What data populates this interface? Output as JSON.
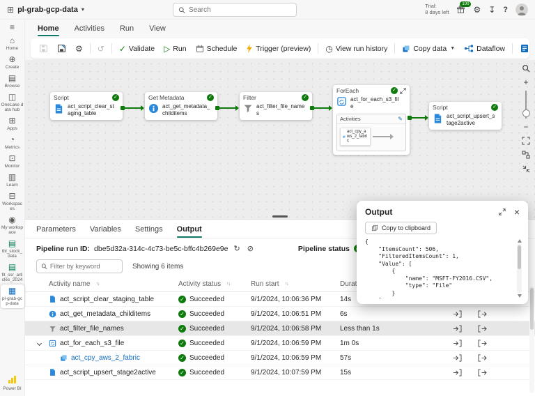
{
  "topbar": {
    "workspace": "pl-grab-gcp-data",
    "search_placeholder": "Search",
    "trial_line1": "Trial:",
    "trial_line2": "8 days left",
    "badge": "100"
  },
  "sidebar": {
    "items": [
      {
        "label": "Home"
      },
      {
        "label": "Create"
      },
      {
        "label": "Browse"
      },
      {
        "label": "OneLake data hub"
      },
      {
        "label": "Apps"
      },
      {
        "label": "Metrics"
      },
      {
        "label": "Monitor"
      },
      {
        "label": "Learn"
      },
      {
        "label": "Workspaces"
      },
      {
        "label": "My workspace"
      },
      {
        "label": "tbl_stock_data"
      },
      {
        "label": "fit_ssr_articles_2024"
      },
      {
        "label": "pl-grab-gcp-data"
      },
      {
        "label": "Power BI"
      }
    ]
  },
  "menu": {
    "tabs": [
      {
        "label": "Home"
      },
      {
        "label": "Activities"
      },
      {
        "label": "Run"
      },
      {
        "label": "View"
      }
    ]
  },
  "toolbar": {
    "validate": "Validate",
    "run": "Run",
    "schedule": "Schedule",
    "trigger": "Trigger (preview)",
    "history": "View run history",
    "copy_data": "Copy data",
    "dataflow": "Dataflow"
  },
  "canvas": {
    "nodes": [
      {
        "type": "Script",
        "name": "act_script_clear_staging_table"
      },
      {
        "type": "Get Metadata",
        "name": "act_get_metadata_childitems"
      },
      {
        "type": "Filter",
        "name": "act_filter_file_names"
      },
      {
        "type": "ForEach",
        "name": "act_for_each_s3_file",
        "activities_label": "Activities",
        "inner_name": "act_cpy_aws_2_fabric"
      },
      {
        "type": "Script",
        "name": "act_script_upsert_stage2active"
      }
    ]
  },
  "panel": {
    "tabs": [
      {
        "label": "Parameters"
      },
      {
        "label": "Variables"
      },
      {
        "label": "Settings"
      },
      {
        "label": "Output"
      }
    ],
    "run_id_label": "Pipeline run ID:",
    "run_id": "dbe5d32a-314c-4c73-be5c-bffc4b269e9e",
    "status_label": "Pipeline status",
    "status_value": "Succeeded",
    "filter_placeholder": "Filter by keyword",
    "showing": "Showing 6 items",
    "columns": [
      {
        "label": "Activity name"
      },
      {
        "label": "Activity status"
      },
      {
        "label": "Run start"
      },
      {
        "label": "Duration"
      }
    ],
    "rows": [
      {
        "name": "act_script_clear_staging_table",
        "status": "Succeeded",
        "start": "9/1/2024, 10:06:36 PM",
        "duration": "14s"
      },
      {
        "name": "act_get_metadata_childitems",
        "status": "Succeeded",
        "start": "9/1/2024, 10:06:51 PM",
        "duration": "6s"
      },
      {
        "name": "act_filter_file_names",
        "status": "Succeeded",
        "start": "9/1/2024, 10:06:58 PM",
        "duration": "Less than 1s"
      },
      {
        "name": "act_for_each_s3_file",
        "status": "Succeeded",
        "start": "9/1/2024, 10:06:59 PM",
        "duration": "1m 0s"
      },
      {
        "name": "act_cpy_aws_2_fabric",
        "status": "Succeeded",
        "start": "9/1/2024, 10:06:59 PM",
        "duration": "57s"
      },
      {
        "name": "act_script_upsert_stage2active",
        "status": "Succeeded",
        "start": "9/1/2024, 10:07:59 PM",
        "duration": "15s"
      }
    ]
  },
  "output_panel": {
    "title": "Output",
    "copy_button": "Copy to clipboard",
    "json": "{\n    \"ItemsCount\": 506,\n    \"FilteredItemsCount\": 1,\n    \"Value\": [\n        {\n            \"name\": \"MSFT-FY2016.CSV\",\n            \"type\": \"File\"\n        }\n    ]\n}"
  },
  "colors": {
    "accent_green": "#0e7a0b",
    "accent_blue": "#0f6cbd",
    "tab_underline": "#117865",
    "trigger_orange": "#f2a900"
  }
}
